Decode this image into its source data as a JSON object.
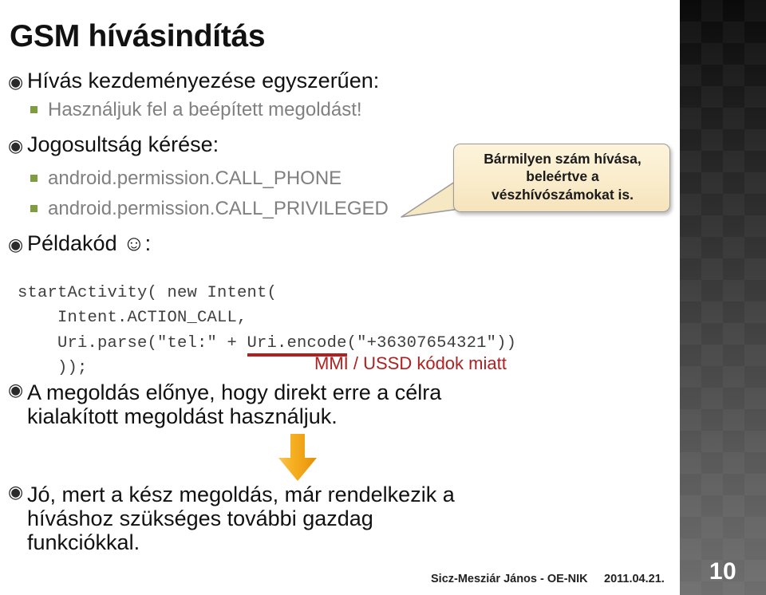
{
  "slide": {
    "title": "GSM hívásindítás",
    "page_number": "10"
  },
  "bullets": {
    "b1": {
      "marker": "◉",
      "text": "Hívás kezdeményezése egyszerűen:"
    },
    "b1s1": {
      "text": "Használjuk fel a beépített megoldást!"
    },
    "b2": {
      "marker": "◉",
      "text": "Jogosultság kérése:"
    },
    "b2s1": {
      "text": "android.permission.CALL_PHONE"
    },
    "b2s2": {
      "text": "android.permission.CALL_PRIVILEGED"
    },
    "b3": {
      "marker": "◉",
      "text": "Példakód ☺:"
    },
    "b4": {
      "marker": "◉",
      "text": "A megoldás előnye, hogy direkt erre a célra kialakított megoldást használjuk."
    },
    "b5": {
      "marker": "◉",
      "text": "Jó, mert a kész megoldás, már rendelkezik a híváshoz szükséges további gazdag funkciókkal."
    }
  },
  "code": {
    "line1": "startActivity( new Intent(",
    "line2": "    Intent.ACTION_CALL,",
    "line3_pre": "    Uri.parse(\"tel:\" + ",
    "line3_underlined": "Uri.encode",
    "line3_post": "(\"+36307654321\"))",
    "line4": "    ));",
    "note": "MMI / USSD kódok miatt",
    "note_color": "#b02020"
  },
  "callout": {
    "line1": "Bármilyen szám hívása,",
    "line2": "beleértve a",
    "line3": "vészhívószámokat is.",
    "fill_color": "#faeccb",
    "border_color": "#9a9a9a"
  },
  "arrow": {
    "name": "down-arrow",
    "color": "#f5a81c"
  },
  "footer": {
    "author": "Sicz-Mesziár János - OE-NIK",
    "date": "2011.04.21."
  },
  "theme": {
    "sub_bullet_color": "#808080",
    "sub_bullet_square_color": "#7f9c40",
    "strip_top": "#0a0a0a",
    "strip_bottom": "#6e6e6e"
  }
}
